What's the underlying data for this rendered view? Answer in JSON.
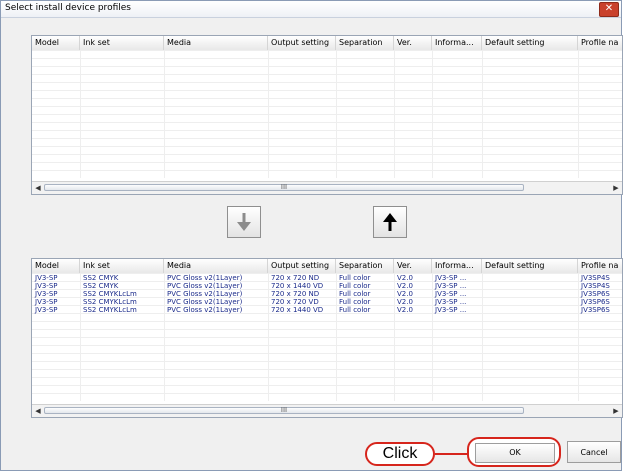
{
  "window": {
    "title": "Select install device profiles",
    "close_glyph": "✕"
  },
  "columns": [
    "Model",
    "Ink set",
    "Media",
    "Output setting",
    "Separation",
    "Ver.",
    "Informa...",
    "Default setting",
    "Profile na"
  ],
  "top_list": {
    "rows": [],
    "scroll_grip": "III"
  },
  "bottom_list": {
    "rows": [
      [
        "JV3-SP",
        "SS2 CMYK",
        "PVC Gloss v2(1Layer)",
        "720 x 720 ND",
        "Full color",
        "V2.0",
        "JV3-SP ...",
        "",
        "JV3SP4S"
      ],
      [
        "JV3-SP",
        "SS2 CMYK",
        "PVC Gloss v2(1Layer)",
        "720 x 1440 VD",
        "Full color",
        "V2.0",
        "JV3-SP ...",
        "",
        "JV3SP4S"
      ],
      [
        "JV3-SP",
        "SS2 CMYKLcLm",
        "PVC Gloss v2(1Layer)",
        "720 x 720 ND",
        "Full color",
        "V2.0",
        "JV3-SP ...",
        "",
        "JV3SP6S"
      ],
      [
        "JV3-SP",
        "SS2 CMYKLcLm",
        "PVC Gloss v2(1Layer)",
        "720 x 720 VD",
        "Full color",
        "V2.0",
        "JV3-SP ...",
        "",
        "JV3SP6S"
      ],
      [
        "JV3-SP",
        "SS2 CMYKLcLm",
        "PVC Gloss v2(1Layer)",
        "720 x 1440 VD",
        "Full color",
        "V2.0",
        "JV3-SP ...",
        "",
        "JV3SP6S"
      ]
    ],
    "scroll_grip": "III"
  },
  "buttons": {
    "move_down_icon": "arrow-down-icon",
    "move_up_icon": "arrow-up-icon",
    "ok": "OK",
    "cancel": "Cancel"
  },
  "annotation": {
    "callout": "Click"
  },
  "colors": {
    "cell_text": "#1a2a8a",
    "highlight": "#d6251c",
    "close_button": "#c9412c"
  }
}
